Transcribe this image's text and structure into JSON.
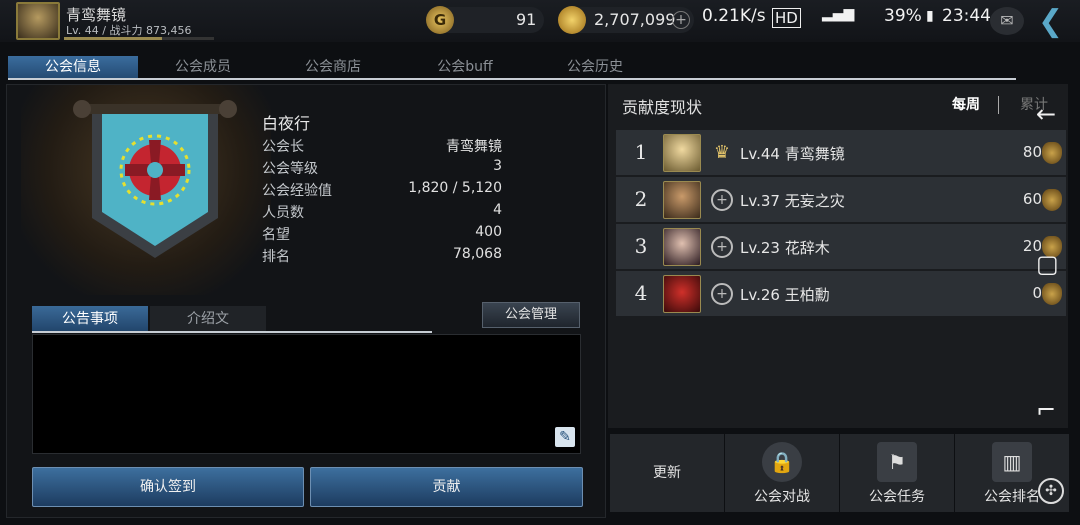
{
  "player": {
    "name": "青鸾舞镜",
    "stats": "Lv. 44 / 战斗力 873,456",
    "level_progress": 0.65
  },
  "resources": {
    "g_icon": "G",
    "g_value": "91",
    "gold_value": "2,707,099"
  },
  "status": {
    "speed": "0.21K/s",
    "hd": "HD",
    "battery": "39%",
    "time": "23:44"
  },
  "tabs": [
    "公会信息",
    "公会成员",
    "公会商店",
    "公会buff",
    "公会历史"
  ],
  "guild": {
    "name": "白夜行",
    "info": [
      {
        "label": "公会长",
        "value": "青鸾舞镜"
      },
      {
        "label": "公会等级",
        "value": "3"
      },
      {
        "label": "公会经验值",
        "value": "1,820 / 5,120"
      },
      {
        "label": "人员数",
        "value": "4"
      },
      {
        "label": "名望",
        "value": "400"
      },
      {
        "label": "排名",
        "value": "78,068"
      }
    ]
  },
  "sub_tabs": [
    "公告事项",
    "介绍文"
  ],
  "manage_button": "公会管理",
  "checkin_button": "确认签到",
  "contribute_button": "贡献",
  "contribution": {
    "title": "贡献度现状",
    "tab_weekly": "每周",
    "tab_total": "累计",
    "rows": [
      {
        "rank": "1",
        "level_name": "Lv.44 青鸾舞镜",
        "points": "80",
        "leader": true
      },
      {
        "rank": "2",
        "level_name": "Lv.37 无妄之灾",
        "points": "60",
        "leader": false
      },
      {
        "rank": "3",
        "level_name": "Lv.23 花辞木",
        "points": "20",
        "leader": false
      },
      {
        "rank": "4",
        "level_name": "Lv.26 王柏勳",
        "points": "0",
        "leader": false
      }
    ]
  },
  "bottom": {
    "refresh": "更新",
    "battle": "公会对战",
    "mission": "公会任务",
    "ranking": "公会排名"
  },
  "colors": {
    "accent": "#3b6d9e",
    "banner": "#4fb3c6",
    "emblem": "#b7202a",
    "gold": "#e2c36a"
  }
}
